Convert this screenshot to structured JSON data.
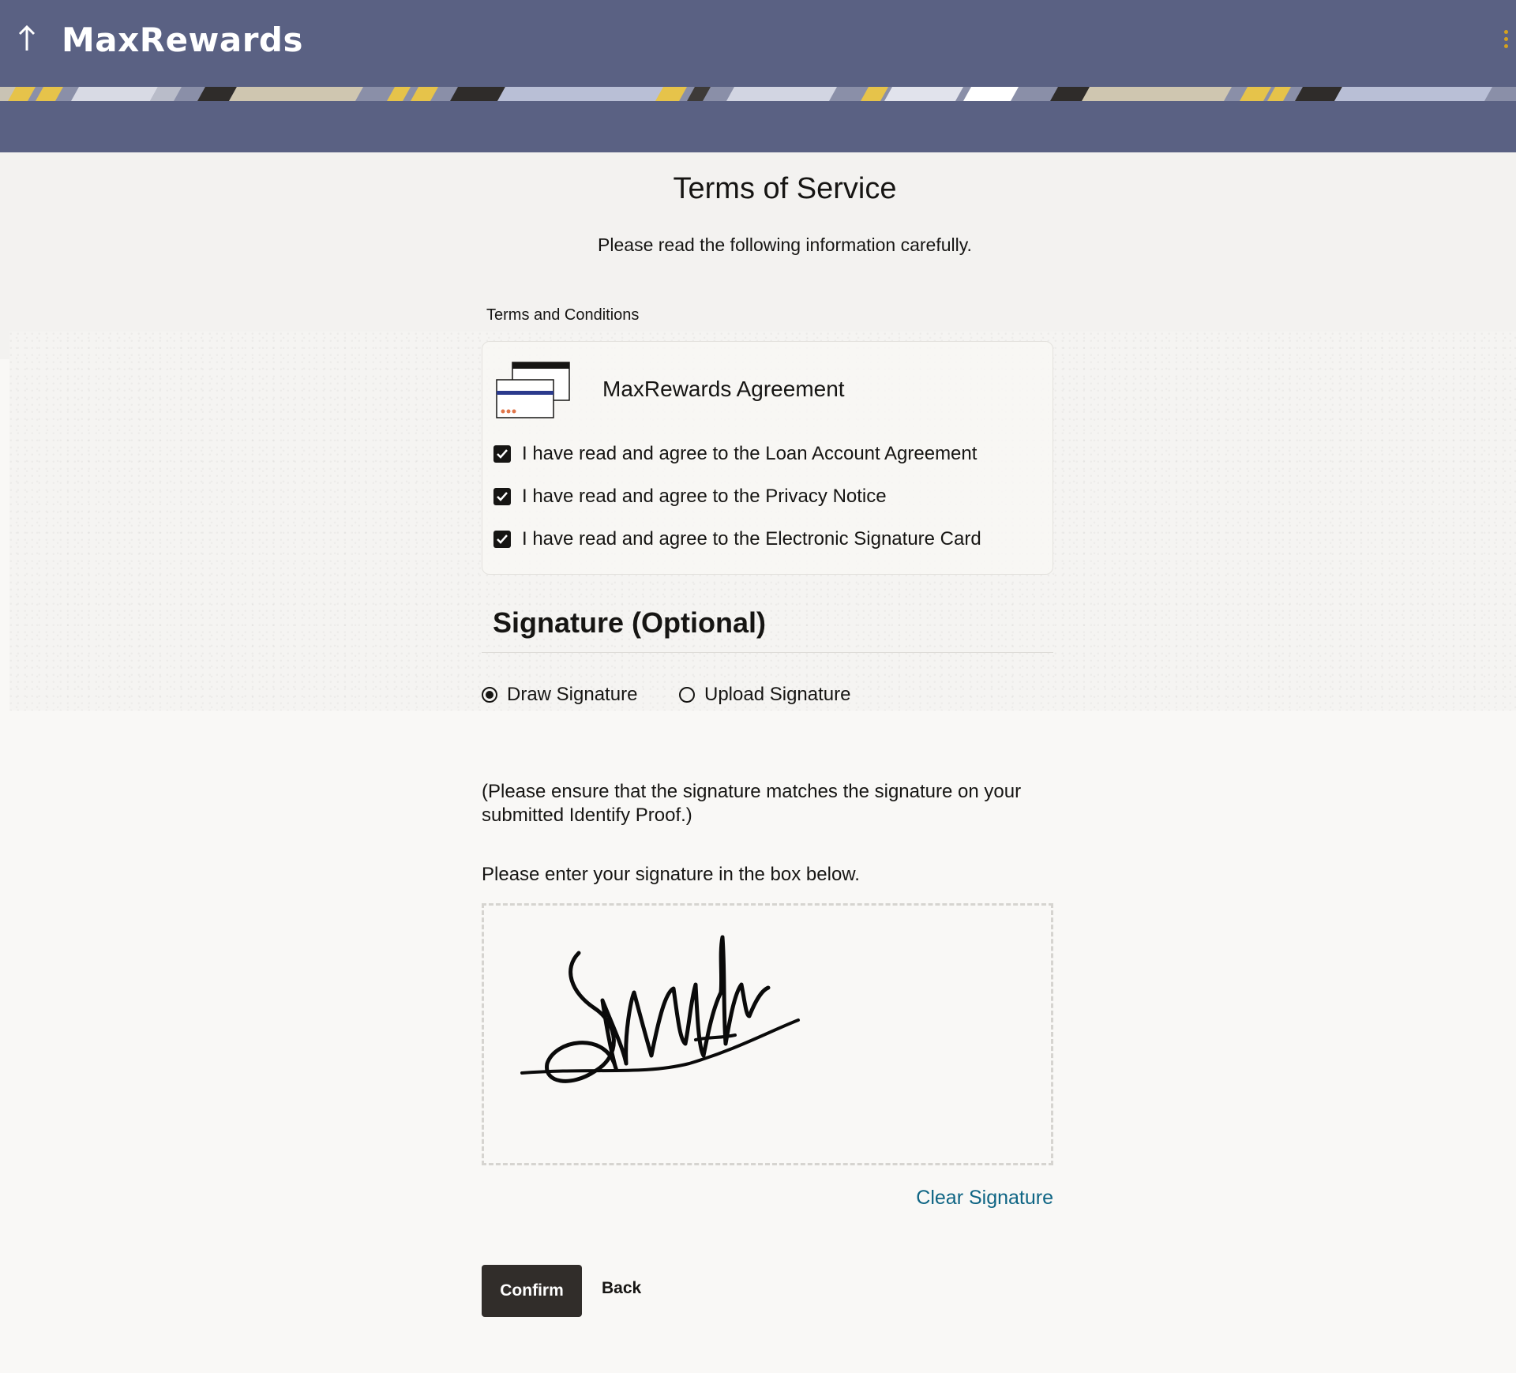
{
  "app": {
    "title": "MaxRewards"
  },
  "colors": {
    "header_bg": "#5a6183",
    "accent_gold": "#d4a21e",
    "link": "#0f6584",
    "primary_button": "#312d2a"
  },
  "page": {
    "title": "Terms of Service",
    "subtitle": "Please read the following information carefully."
  },
  "terms": {
    "section_label": "Terms and Conditions",
    "card_title": "MaxRewards Agreement",
    "card_icon": "credit-cards-icon",
    "items": [
      {
        "label": "I have read and agree to the Loan Account Agreement",
        "checked": true
      },
      {
        "label": "I have read and agree to the Privacy Notice",
        "checked": true
      },
      {
        "label": "I have read and agree to the Electronic Signature Card",
        "checked": true
      }
    ]
  },
  "signature": {
    "heading": "Signature (Optional)",
    "options": [
      {
        "label": "Draw Signature",
        "selected": true
      },
      {
        "label": "Upload Signature",
        "selected": false
      }
    ],
    "note": "(Please ensure that the signature matches the signature on your submitted Identify Proof.)",
    "instruction": "Please enter your signature in the box below.",
    "clear_label": "Clear Signature"
  },
  "actions": {
    "confirm_label": "Confirm",
    "back_label": "Back"
  }
}
